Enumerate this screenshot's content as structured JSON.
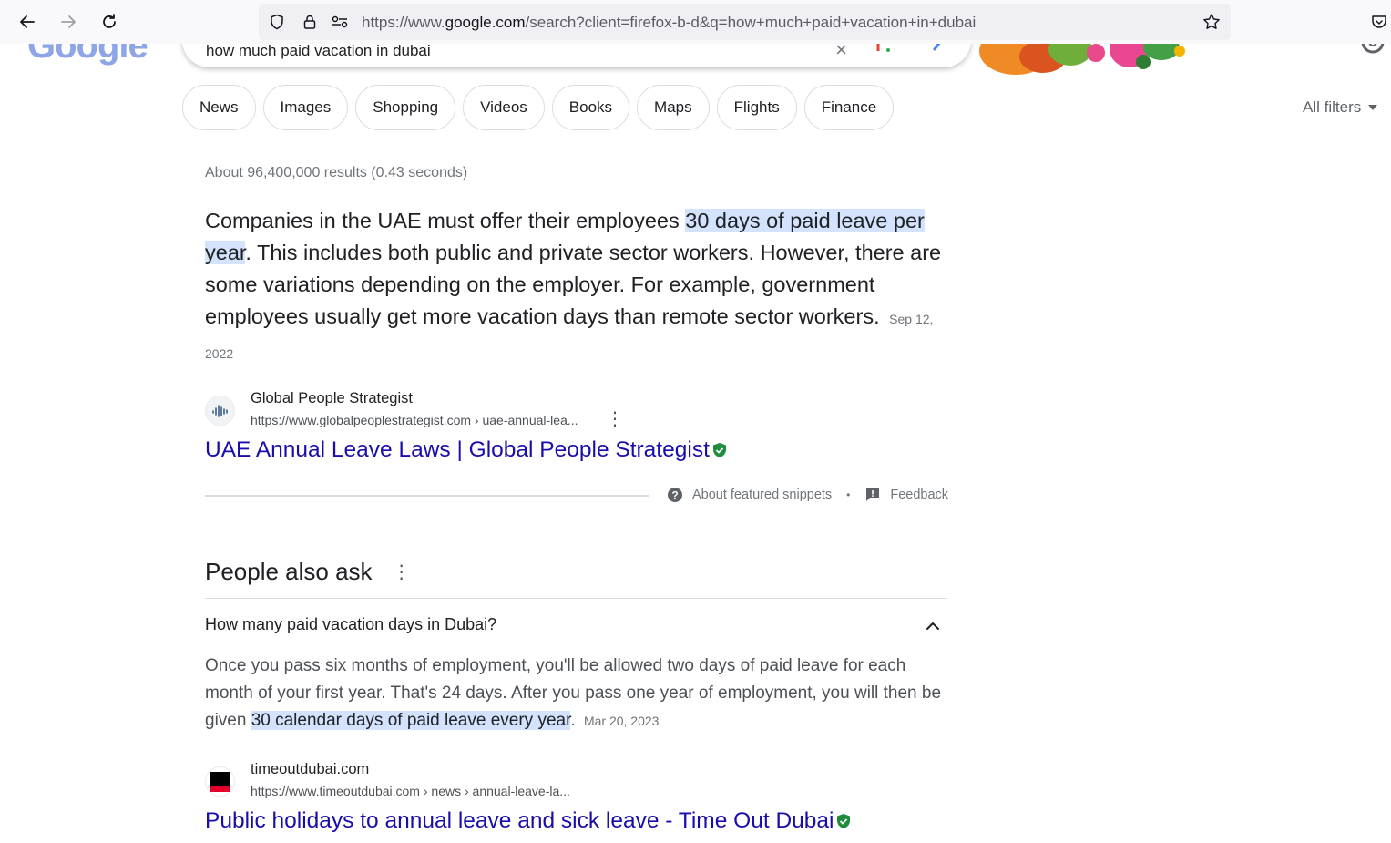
{
  "browser": {
    "url_prefix": "https://www.",
    "url_host": "google.com",
    "url_rest": "/search?client=firefox-b-d&q=how+much+paid+vacation+in+dubai"
  },
  "search": {
    "query": "how much paid vacation in dubai",
    "logo_text": "Google"
  },
  "tabs": [
    {
      "label": "News"
    },
    {
      "label": "Images"
    },
    {
      "label": "Shopping"
    },
    {
      "label": "Videos"
    },
    {
      "label": "Books"
    },
    {
      "label": "Maps"
    },
    {
      "label": "Flights"
    },
    {
      "label": "Finance"
    }
  ],
  "all_filters_label": "All filters",
  "result_stats": "About 96,400,000 results (0.43 seconds)",
  "featured": {
    "text_before": "Companies in the UAE must offer their employees ",
    "text_highlight": "30 days of paid leave per year",
    "text_after": ". This includes both public and private sector workers. However, there are some variations depending on the employer. For example, government employees usually get more vacation days than remote sector workers.",
    "date": "Sep 12, 2022",
    "source_name": "Global People Strategist",
    "source_url": "https://www.globalpeoplestrategist.com › uae-annual-lea...",
    "title": "UAE Annual Leave Laws | Global People Strategist",
    "about_label": "About featured snippets",
    "feedback_label": "Feedback"
  },
  "paa": {
    "heading": "People also ask",
    "question": "How many paid vacation days in Dubai?",
    "answer_before": "Once you pass six months of employment, you'll be allowed two days of paid leave for each month of your first year. That's 24 days. After you pass one year of employment, you will then be given ",
    "answer_highlight": "30 calendar days of paid leave every year",
    "answer_after": ".",
    "date": "Mar 20, 2023",
    "source_name": "timeoutdubai.com",
    "source_url": "https://www.timeoutdubai.com › news › annual-leave-la...",
    "title": "Public holidays to annual leave and sick leave - Time Out Dubai"
  },
  "colors": {
    "link": "#1a0dab",
    "highlight": "#d3e3fd",
    "verified": "#1e8e3e"
  }
}
